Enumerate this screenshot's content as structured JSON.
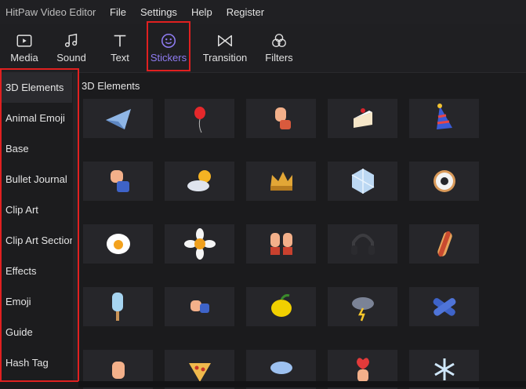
{
  "app": {
    "title": "HitPaw Video Editor"
  },
  "menu": [
    "File",
    "Settings",
    "Help",
    "Register"
  ],
  "toolbar": {
    "active": "Stickers",
    "accent_color": "#8f7cf2",
    "tabs": [
      {
        "label": "Media",
        "icon": "media-icon"
      },
      {
        "label": "Sound",
        "icon": "music-note-icon"
      },
      {
        "label": "Text",
        "icon": "text-icon"
      },
      {
        "label": "Stickers",
        "icon": "sticker-smiley-icon"
      },
      {
        "label": "Transition",
        "icon": "transition-bowtie-icon"
      },
      {
        "label": "Filters",
        "icon": "filters-circles-icon"
      }
    ]
  },
  "sidebar": {
    "items": [
      "3D Elements",
      "Animal Emoji",
      "Base",
      "Bullet Journal",
      "Clip Art",
      "Clip Art Section",
      "Effects",
      "Emoji",
      "Guide",
      "Hash Tag"
    ],
    "selected": "3D Elements"
  },
  "content": {
    "section_title": "3D Elements",
    "stickers": [
      "paper-plane",
      "balloon",
      "waving-hand",
      "cake-slice",
      "party-hat",
      "clapping-hand",
      "sun-behind-cloud",
      "crown",
      "ice-cube",
      "donut",
      "fried-egg",
      "daisy",
      "raised-hands",
      "headphones",
      "hot-dog",
      "popsicle",
      "fist-bump",
      "lemon",
      "thunder-cloud",
      "crossed-arms",
      "ok-hand",
      "pizza-slice",
      "rain-cloud",
      "finger-heart",
      "snowflake"
    ]
  }
}
